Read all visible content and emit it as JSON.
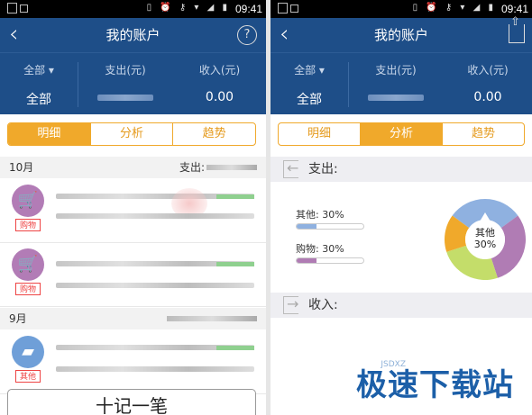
{
  "status_bar": {
    "time": "09:41",
    "icons": "▯ ⏰ ⚷ ▾ ◢ ▮"
  },
  "left_screen": {
    "title": "我的账户",
    "filter_label": "全部 ▾",
    "filter_value": "全部",
    "expense_header": "支出(元)",
    "income_header": "收入(元)",
    "income_value": "0.00",
    "tabs": [
      "明细",
      "分析",
      "趋势"
    ],
    "active_tab": 0,
    "months": [
      {
        "label": "10月",
        "expense_label": "支出:"
      },
      {
        "label": "9月"
      }
    ],
    "entries": [
      {
        "category": "购物",
        "icon": "cart-icon",
        "color": "#b27cb6"
      },
      {
        "category": "购物",
        "icon": "cart-icon",
        "color": "#b27cb6"
      },
      {
        "category": "其他",
        "icon": "folder-icon",
        "color": "#6f9fd8"
      }
    ],
    "add_button": "十记一笔"
  },
  "right_screen": {
    "title": "我的账户",
    "filter_label": "全部 ▾",
    "filter_value": "全部",
    "expense_header": "支出(元)",
    "income_header": "收入(元)",
    "income_value": "0.00",
    "tabs": [
      "明细",
      "分析",
      "趋势"
    ],
    "active_tab": 1,
    "expense_section": "支出:",
    "income_section": "收入:",
    "donut_center_label": "其他",
    "donut_center_value": "30%"
  },
  "chart_data": {
    "type": "pie",
    "categories": [
      "其他",
      "购物",
      "segment-3",
      "segment-4"
    ],
    "values": [
      30,
      30,
      25,
      15
    ],
    "colors": [
      "#8fb1e0",
      "#b07cb4",
      "#c4dd6a",
      "#f0a92b"
    ],
    "legend": [
      {
        "label": "其他: 30%",
        "value": 30,
        "color": "#8fb1e0"
      },
      {
        "label": "购物: 30%",
        "value": 30,
        "color": "#b07cb4"
      }
    ]
  },
  "watermark": {
    "text": "极速下载站",
    "sub": "JSDXZ"
  }
}
